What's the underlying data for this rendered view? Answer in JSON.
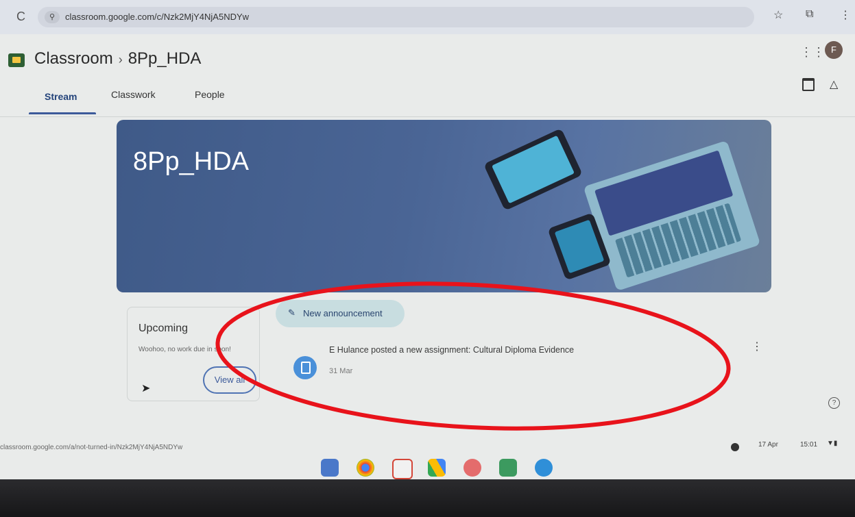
{
  "browser": {
    "url": "classroom.google.com/c/Nzk2MjY4NjA5NDYw",
    "reload_icon": "reload-icon",
    "star_icon": "star-icon",
    "extensions_icon": "extensions-icon",
    "menu_icon": "more-vert-icon"
  },
  "header": {
    "app_name": "Classroom",
    "separator": "›",
    "class_name": "8Pp_HDA",
    "avatar_letter": "F"
  },
  "tabs": [
    {
      "label": "Stream",
      "active": true
    },
    {
      "label": "Classwork",
      "active": false
    },
    {
      "label": "People",
      "active": false
    }
  ],
  "banner": {
    "title": "8Pp_HDA",
    "color": "#4a6595"
  },
  "upcoming": {
    "title": "Upcoming",
    "text": "Woohoo, no work due in soon!",
    "view_all": "View all"
  },
  "stream": {
    "new_announcement": "New announcement",
    "post_text": "E Hulance posted a new assignment: Cultural Diploma Evidence",
    "post_date": "31 Mar"
  },
  "status_bar": {
    "url": "classroom.google.com/a/not-turned-in/Nzk2MjY4NjA5NDYw"
  },
  "tray": {
    "date": "17 Apr",
    "time": "15:01"
  },
  "annotation_color": "#e8131b"
}
